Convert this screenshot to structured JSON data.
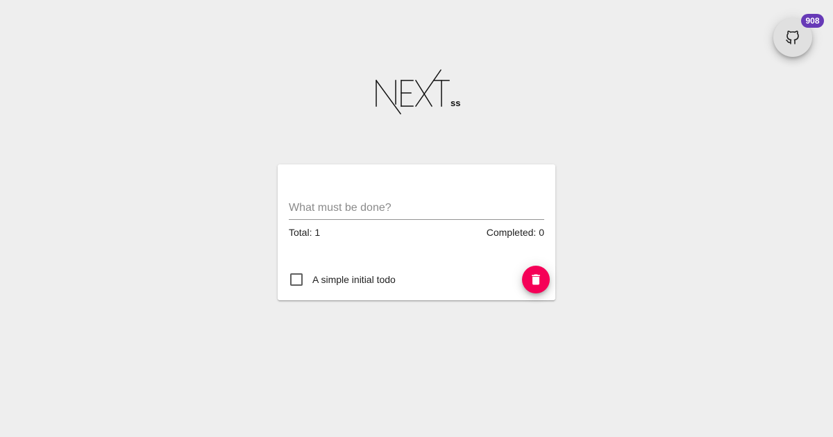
{
  "header": {
    "logo_text": "NEXT",
    "logo_suffix": "ss"
  },
  "github": {
    "icon": "github-icon",
    "badge_count": "908",
    "badge_color": "#673ab7"
  },
  "todo": {
    "input_placeholder": "What must be done?",
    "input_value": "",
    "total_label": "Total: 1",
    "completed_label": "Completed: 0",
    "items": [
      {
        "label": "A simple initial todo",
        "completed": false
      }
    ],
    "delete_icon": "trash-icon",
    "delete_color": "#f50057"
  }
}
